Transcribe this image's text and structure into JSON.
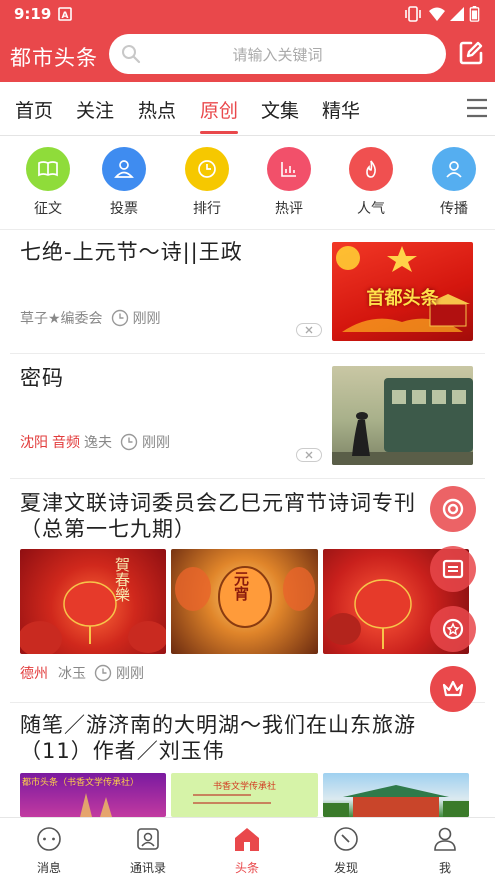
{
  "status_bar": {
    "time": "9:19"
  },
  "header": {
    "app_title": "都市头条",
    "search_placeholder": "请输入关键词"
  },
  "tabs": [
    {
      "label": "首页"
    },
    {
      "label": "关注"
    },
    {
      "label": "热点"
    },
    {
      "label": "原创",
      "active": true
    },
    {
      "label": "文集"
    },
    {
      "label": "精华"
    }
  ],
  "categories": [
    {
      "label": "征文",
      "icon": "book-icon",
      "color": "#8fdc3a"
    },
    {
      "label": "投票",
      "icon": "users-icon",
      "color": "#3f8cf0"
    },
    {
      "label": "排行",
      "icon": "clock-icon",
      "color": "#f6c800"
    },
    {
      "label": "热评",
      "icon": "chart-icon",
      "color": "#f2506a"
    },
    {
      "label": "人气",
      "icon": "flame-icon",
      "color": "#f05050"
    },
    {
      "label": "传播",
      "icon": "person-icon",
      "color": "#55aef0"
    }
  ],
  "articles": [
    {
      "title": "七绝-上元节～诗||王政",
      "author": "草子★编委会",
      "time": "刚刚",
      "thumb_text": "首都头条"
    },
    {
      "title": "密码",
      "location": "沈阳",
      "tag": "音频",
      "author": "逸夫",
      "time": "刚刚"
    },
    {
      "title_line1": "夏津文联诗词委员会乙巳元宵节诗词专刊",
      "title_line2": "（总第一七九期）",
      "location": "德州",
      "author": "冰玉",
      "time": "刚刚",
      "thumb1_text": "賀春樂",
      "thumb2_text": "元宵"
    },
    {
      "title_line1": "随笔／游济南的大明湖～我们在山东旅游",
      "title_line2": "（11）作者／刘玉伟",
      "thumb1_text": "都市头条（书香文学传承社）",
      "thumb2_text": "书香文学传承社"
    }
  ],
  "bottom_nav": [
    {
      "label": "消息",
      "icon": "chat-icon"
    },
    {
      "label": "通讯录",
      "icon": "contacts-icon"
    },
    {
      "label": "头条",
      "icon": "home-icon",
      "active": true
    },
    {
      "label": "发现",
      "icon": "compass-icon"
    },
    {
      "label": "我",
      "icon": "profile-icon"
    }
  ],
  "colors": {
    "brand": "#e9484b",
    "accent_red": "#e23c3c"
  }
}
